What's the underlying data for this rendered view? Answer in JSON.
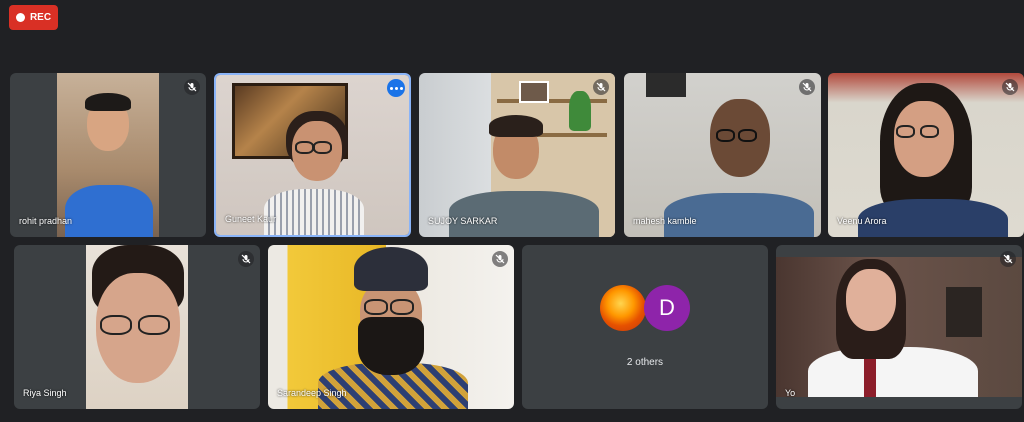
{
  "recording": {
    "label": "REC"
  },
  "participants": [
    {
      "name": "rohit pradhan"
    },
    {
      "name": "Guneet Kaur"
    },
    {
      "name": "SUJOY SARKAR"
    },
    {
      "name": "mahesh kamble"
    },
    {
      "name": "Veenu Arora"
    },
    {
      "name": "Riya Singh"
    },
    {
      "name": "Sarandeep Singh"
    },
    {
      "name": "Yo"
    }
  ],
  "others": {
    "label": "2 others",
    "avatar_letter": "D"
  },
  "colors": {
    "background": "#202124",
    "tile": "#3c4043",
    "rec": "#d93025",
    "active_border": "#8ab4f8",
    "avatar_d": "#8e24aa"
  }
}
